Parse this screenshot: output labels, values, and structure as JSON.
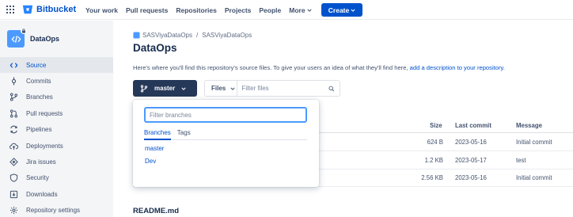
{
  "topnav": {
    "logo_text": "Bitbucket",
    "items": [
      "Your work",
      "Pull requests",
      "Repositories",
      "Projects",
      "People"
    ],
    "more_label": "More",
    "create_label": "Create"
  },
  "sidebar": {
    "repo_name": "DataOps",
    "items": [
      {
        "label": "Source",
        "icon": "code-icon",
        "active": true
      },
      {
        "label": "Commits",
        "icon": "commit-icon"
      },
      {
        "label": "Branches",
        "icon": "branch-icon"
      },
      {
        "label": "Pull requests",
        "icon": "pull-request-icon"
      },
      {
        "label": "Pipelines",
        "icon": "pipelines-icon"
      },
      {
        "label": "Deployments",
        "icon": "cloud-upload-icon"
      },
      {
        "label": "Jira issues",
        "icon": "jira-icon"
      },
      {
        "label": "Security",
        "icon": "shield-icon"
      },
      {
        "label": "Downloads",
        "icon": "download-icon"
      },
      {
        "label": "Repository settings",
        "icon": "gear-icon"
      }
    ]
  },
  "main": {
    "breadcrumb": [
      "SASViyaDataOps",
      "SASViyaDataOps"
    ],
    "breadcrumb_sep": "/",
    "title": "DataOps",
    "description": "Here's where you'll find this repository's source files. To give your users an idea of what they'll find here,",
    "description_link": "add a description to your repository.",
    "branch_label": "master",
    "files_label": "Files",
    "files_placeholder": "Filter files",
    "table": {
      "headers": {
        "size": "Size",
        "last_commit": "Last commit",
        "message": "Message"
      },
      "rows": [
        {
          "size": "624 B",
          "last_commit": "2023-05-16",
          "message": "Initial commit"
        },
        {
          "size": "1.2 KB",
          "last_commit": "2023-05-17",
          "message": "test"
        },
        {
          "size": "2.56 KB",
          "last_commit": "2023-05-16",
          "message": "Initial commit"
        }
      ]
    },
    "readme_title": "README.md"
  },
  "dropdown": {
    "filter_placeholder": "Filter branches",
    "tabs": [
      "Branches",
      "Tags"
    ],
    "branches": [
      "master",
      "Dev"
    ]
  },
  "colors": {
    "brand": "#0052cc",
    "branch_button": "#253858",
    "focus": "#4c9aff"
  }
}
